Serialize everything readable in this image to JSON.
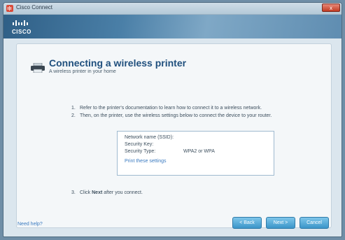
{
  "window": {
    "title": "Cisco Connect",
    "close_label": "x"
  },
  "branding": {
    "logo_text": "CISCO"
  },
  "page": {
    "title": "Connecting a wireless printer",
    "subtitle": "A wireless printer in your home",
    "steps": [
      {
        "number": "1.",
        "text": "Refer to the printer's documentation to learn how to connect it to a wireless network."
      },
      {
        "number": "2.",
        "text": "Then, on the printer, use the wireless settings below to connect the device to your router."
      }
    ],
    "step3": {
      "number": "3.",
      "prefix": "Click ",
      "bold": "Next",
      "suffix": " after you connect."
    }
  },
  "settings": {
    "network_name_label": "Network name (SSID):",
    "network_name_value": "",
    "security_key_label": "Security Key:",
    "security_key_value": "",
    "security_type_label": "Security Type:",
    "security_type_value": "WPA2 or WPA",
    "print_link": "Print these settings"
  },
  "footer": {
    "help_link": "Need help?",
    "back_button": "< Back",
    "next_button": "Next >",
    "cancel_button": "Cancel"
  },
  "colors": {
    "accent": "#3b95c9",
    "title_blue": "#1f4f7d",
    "link_blue": "#3a7ac0"
  }
}
